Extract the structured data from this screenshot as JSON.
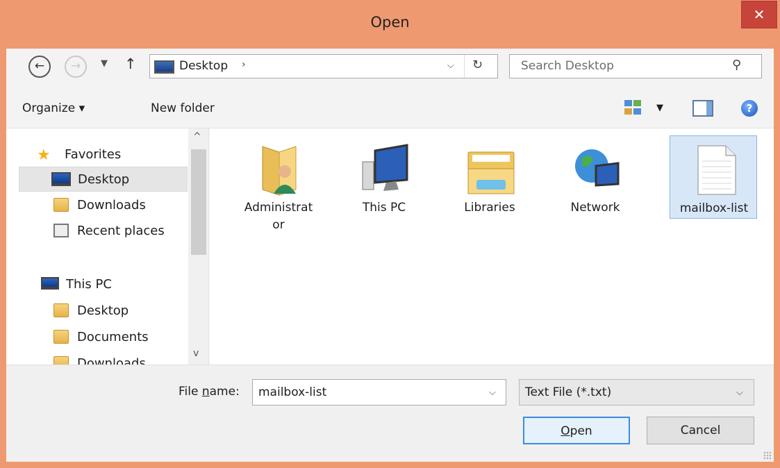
{
  "window": {
    "title": "Open",
    "close_glyph": "✕"
  },
  "navbar": {
    "back_glyph": "←",
    "forward_glyph": "→",
    "recent_glyph": "▼",
    "up_glyph": "↑",
    "address": {
      "location": "Desktop",
      "chevron": "›",
      "drop_glyph": "⌵",
      "refresh_glyph": "↻"
    },
    "search": {
      "placeholder": "Search Desktop",
      "icon_glyph": "⚲"
    }
  },
  "toolbar": {
    "organize_label": "Organize ▾",
    "new_folder_label": "New folder",
    "views_drop_glyph": "▼",
    "help_glyph": "?"
  },
  "navpane": {
    "scroll_up_glyph": "^",
    "scroll_down_glyph": "v",
    "favorites": {
      "label": "Favorites",
      "items": [
        {
          "label": "Desktop",
          "icon": "desktop-icon",
          "selected": true
        },
        {
          "label": "Downloads",
          "icon": "downloads-folder-icon"
        },
        {
          "label": "Recent places",
          "icon": "recent-places-icon"
        }
      ]
    },
    "this_pc": {
      "label": "This PC",
      "items": [
        {
          "label": "Desktop",
          "icon": "desktop-folder-icon"
        },
        {
          "label": "Documents",
          "icon": "documents-folder-icon"
        },
        {
          "label": "Downloads",
          "icon": "downloads-folder-icon"
        }
      ]
    }
  },
  "content": {
    "items": [
      {
        "label": "Administrat",
        "label2": "or",
        "icon": "user-folder-icon"
      },
      {
        "label": "This PC",
        "icon": "computer-icon"
      },
      {
        "label": "Libraries",
        "icon": "libraries-icon"
      },
      {
        "label": "Network",
        "icon": "network-icon"
      },
      {
        "label": "mailbox-list",
        "icon": "text-file-icon",
        "selected": true
      }
    ]
  },
  "bottom": {
    "file_name_label_pre": "File ",
    "file_name_label_u": "n",
    "file_name_label_post": "ame:",
    "file_name_value": "mailbox-list",
    "file_type_value": "Text File (*.txt)",
    "drop_glyph": "⌵",
    "open_label_u": "O",
    "open_label_rest": "pen",
    "cancel_label": "Cancel"
  },
  "colors": {
    "titlebar": "#ef9970",
    "close": "#c7443a",
    "selection": "#d8e7f8",
    "accent": "#3c8ce0"
  }
}
